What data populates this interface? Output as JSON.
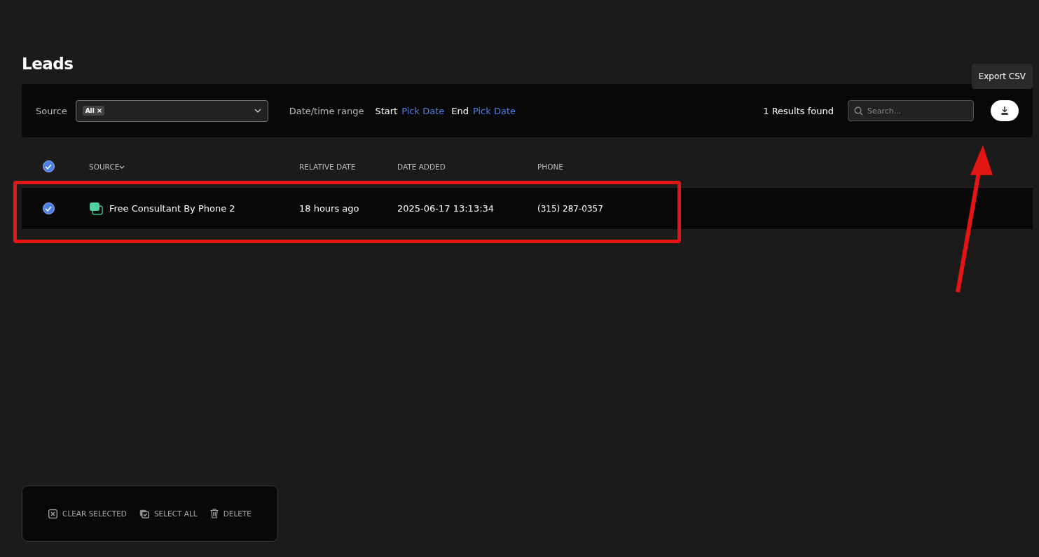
{
  "title": "Leads",
  "filters": {
    "source_label": "Source",
    "source_tags": [
      "All"
    ],
    "date_label": "Date/time range",
    "start_label": "Start",
    "start_value": "Pick Date",
    "end_label": "End",
    "end_value": "Pick Date",
    "results": "1 Results found",
    "search_placeholder": "Search...",
    "export_tooltip": "Export CSV"
  },
  "table": {
    "all_checked": true,
    "columns": [
      "SOURCE",
      "RELATIVE DATE",
      "DATE ADDED",
      "PHONE"
    ],
    "rows": [
      {
        "checked": true,
        "source": "Free Consultant By Phone 2",
        "relative_date": "18 hours ago",
        "date_added": "2025-06-17 13:13:34",
        "phone": "(315) 287-0357"
      }
    ]
  },
  "actions": [
    "CLEAR SELECTED",
    "SELECT ALL",
    "DELETE"
  ]
}
